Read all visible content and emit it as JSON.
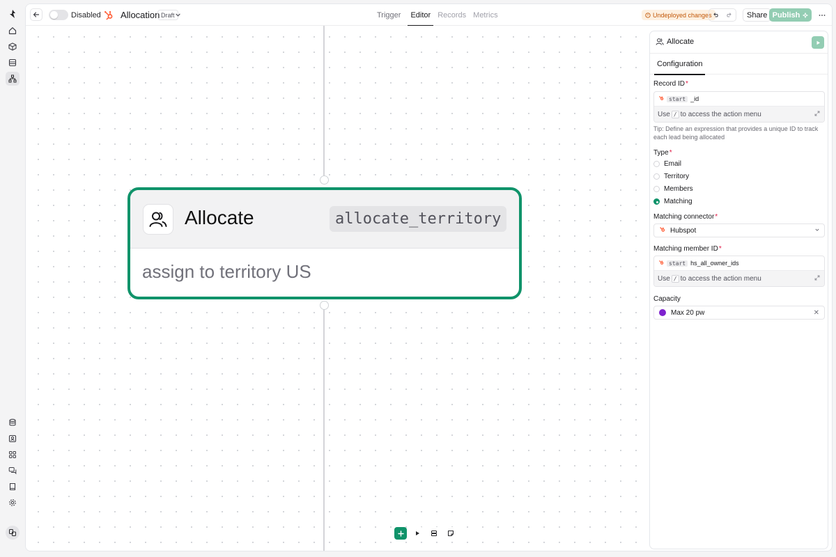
{
  "topbar": {
    "toggle_label": "Disabled",
    "title": "Allocation",
    "status": "Draft",
    "tabs": [
      {
        "label": "Trigger"
      },
      {
        "label": "Editor"
      },
      {
        "label": "Records"
      },
      {
        "label": "Metrics"
      }
    ],
    "active_tab": "Editor",
    "undeployed": "Undeployed changes",
    "share": "Share",
    "publish": "Publish"
  },
  "node": {
    "title": "Allocate",
    "code": "allocate_territory",
    "description": "assign to territory US",
    "border_color": "#10936a"
  },
  "panel": {
    "title": "Allocate",
    "tab": "Configuration",
    "record_id": {
      "label": "Record ID",
      "chip": "start",
      "value": "_id",
      "hint_before": "Use",
      "hint_key": "/",
      "hint_after": "to access the action menu"
    },
    "tip": "Tip: Define an expression that provides a unique ID to track each lead being allocated",
    "type": {
      "label": "Type",
      "options": [
        "Email",
        "Territory",
        "Members",
        "Matching"
      ],
      "selected": "Matching"
    },
    "matching_connector": {
      "label": "Matching connector",
      "value": "Hubspot"
    },
    "matching_member_id": {
      "label": "Matching member ID",
      "chip": "start",
      "value": "hs_all_owner_ids",
      "hint_before": "Use",
      "hint_key": "/",
      "hint_after": "to access the action menu"
    },
    "capacity": {
      "label": "Capacity",
      "value": "Max 20 pw"
    }
  },
  "colors": {
    "accent": "#10936a",
    "hubspot": "#ff5c35",
    "capacity_dot": "#7e22ce",
    "warning": "#c2590a"
  }
}
